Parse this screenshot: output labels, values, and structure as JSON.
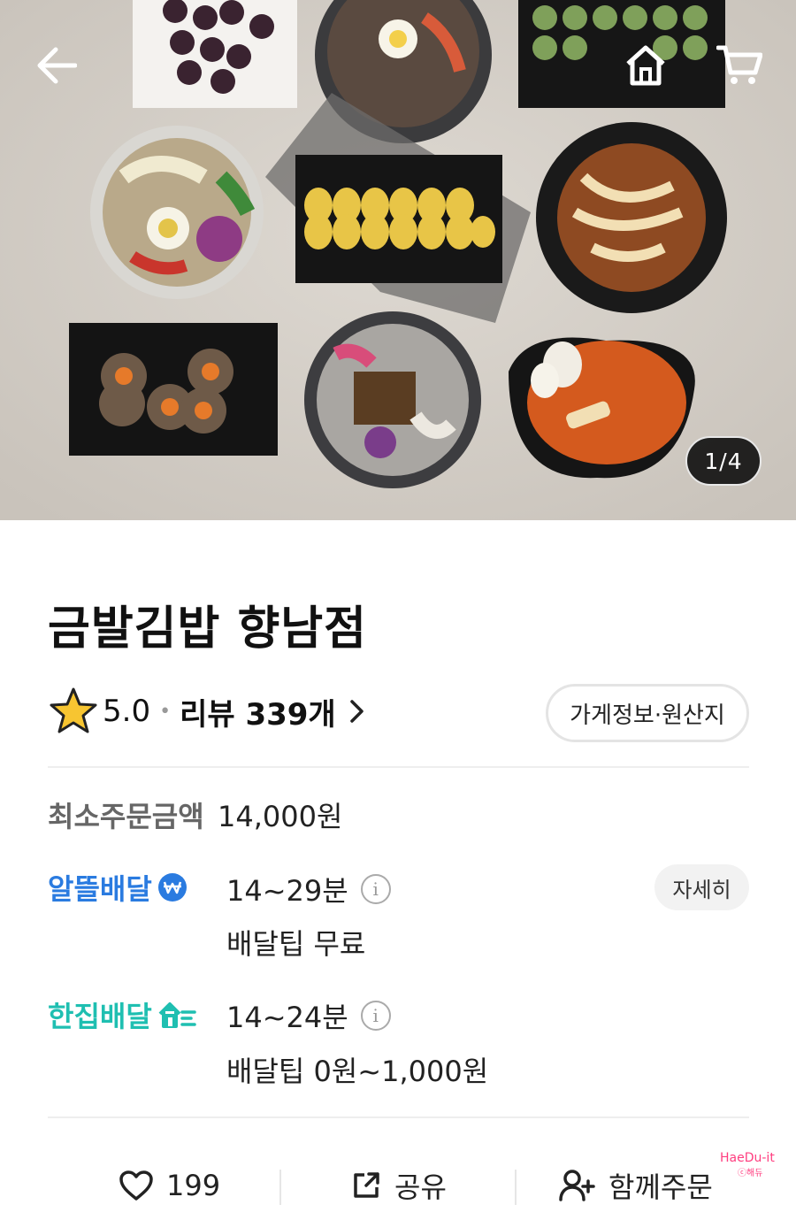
{
  "hero": {
    "counter": "1/4",
    "icons": {
      "back": "arrow-left-icon",
      "home": "home-icon",
      "cart": "cart-icon"
    }
  },
  "store": {
    "name": "금발김밥 향남점",
    "rating": "5.0",
    "review_label": "리뷰 339개",
    "info_button": "가게정보·원산지"
  },
  "order": {
    "min_label": "최소주문금액",
    "min_value": "14,000원"
  },
  "delivery": {
    "alddeul": {
      "brand": "알뜰배달",
      "time": "14~29분",
      "tip": "배달팁 무료",
      "color": "#2a7be0"
    },
    "hanjip": {
      "brand": "한집배달",
      "time": "14~24분",
      "tip": "배달팁 0원~1,000원",
      "color": "#1fbfb1"
    },
    "detail_button": "자세히"
  },
  "actions": {
    "like_count": "199",
    "share": "공유",
    "together": "함께주문"
  },
  "watermark": {
    "main": "HaeDu-it",
    "sub": "ⓒ해듀"
  }
}
